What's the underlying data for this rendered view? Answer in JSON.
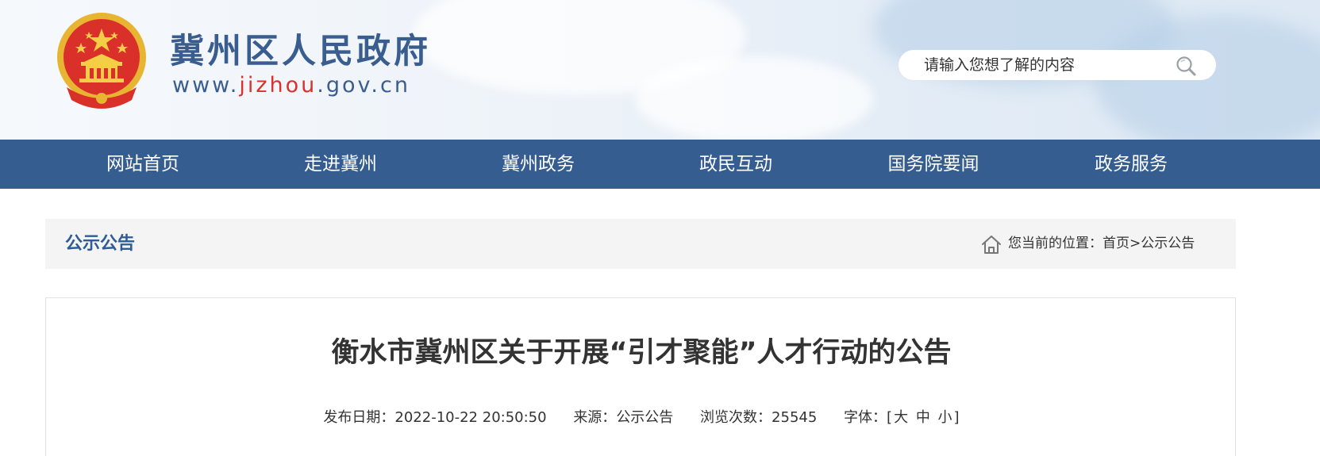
{
  "header": {
    "site_title": "冀州区人民政府",
    "url_prefix": "www.",
    "url_highlight": "jizhou",
    "url_suffix": ".gov.cn",
    "search": {
      "placeholder": "请输入您想了解的内容",
      "icon": "search-icon"
    },
    "emblem": "national-emblem"
  },
  "nav": {
    "items": [
      {
        "label": "网站首页"
      },
      {
        "label": "走进冀州"
      },
      {
        "label": "冀州政务"
      },
      {
        "label": "政民互动"
      },
      {
        "label": "国务院要闻"
      },
      {
        "label": "政务服务"
      }
    ]
  },
  "section": {
    "title": "公示公告",
    "breadcrumb_prefix": "您当前的位置：",
    "breadcrumb_home": "首页",
    "breadcrumb_sep": ">",
    "breadcrumb_current": "公示公告",
    "home_icon": "home-icon"
  },
  "article": {
    "title": "衡水市冀州区关于开展“引才聚能”人才行动的公告",
    "date_label": "发布日期：",
    "date_value": "2022-10-22  20:50:50",
    "source_label": "来源：",
    "source_value": "公示公告",
    "views_label": "浏览次数：",
    "views_value": "25545",
    "font_label": "字体：",
    "font_open": "[",
    "font_large": "大",
    "font_medium": "中",
    "font_small": "小",
    "font_close": "]"
  },
  "colors": {
    "nav_bg": "#355d90",
    "title_blue": "#3a5d8f",
    "url_red": "#d7322c",
    "section_blue": "#2f5d93"
  }
}
